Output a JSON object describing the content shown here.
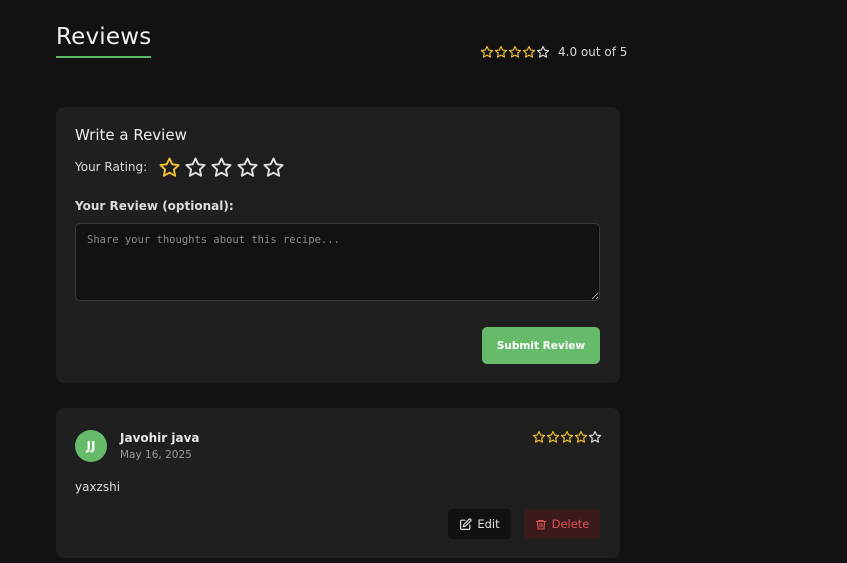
{
  "section": {
    "title": "Reviews",
    "average_rating": 4,
    "average_text": "4.0 out of 5"
  },
  "form": {
    "title": "Write a Review",
    "rating_label": "Your Rating:",
    "selected_rating": 1,
    "max_rating": 5,
    "review_label": "Your Review (optional):",
    "review_value": "",
    "review_placeholder": "Share your thoughts about this recipe...",
    "submit_label": "Submit Review"
  },
  "reviews": [
    {
      "initials": "JJ",
      "author": "Javohir java",
      "date": "May 16, 2025",
      "rating": 4,
      "text": "yaxzshi",
      "edit_label": "Edit",
      "delete_label": "Delete"
    }
  ],
  "colors": {
    "accent": "#66bb6a",
    "star_filled": "#f2c230",
    "star_empty": "#e0e0e0",
    "danger": "#e05252",
    "background": "#121212",
    "card": "#1f1f1f"
  },
  "icons": {
    "star": "star-icon",
    "edit": "edit-icon",
    "delete": "trash-icon"
  }
}
